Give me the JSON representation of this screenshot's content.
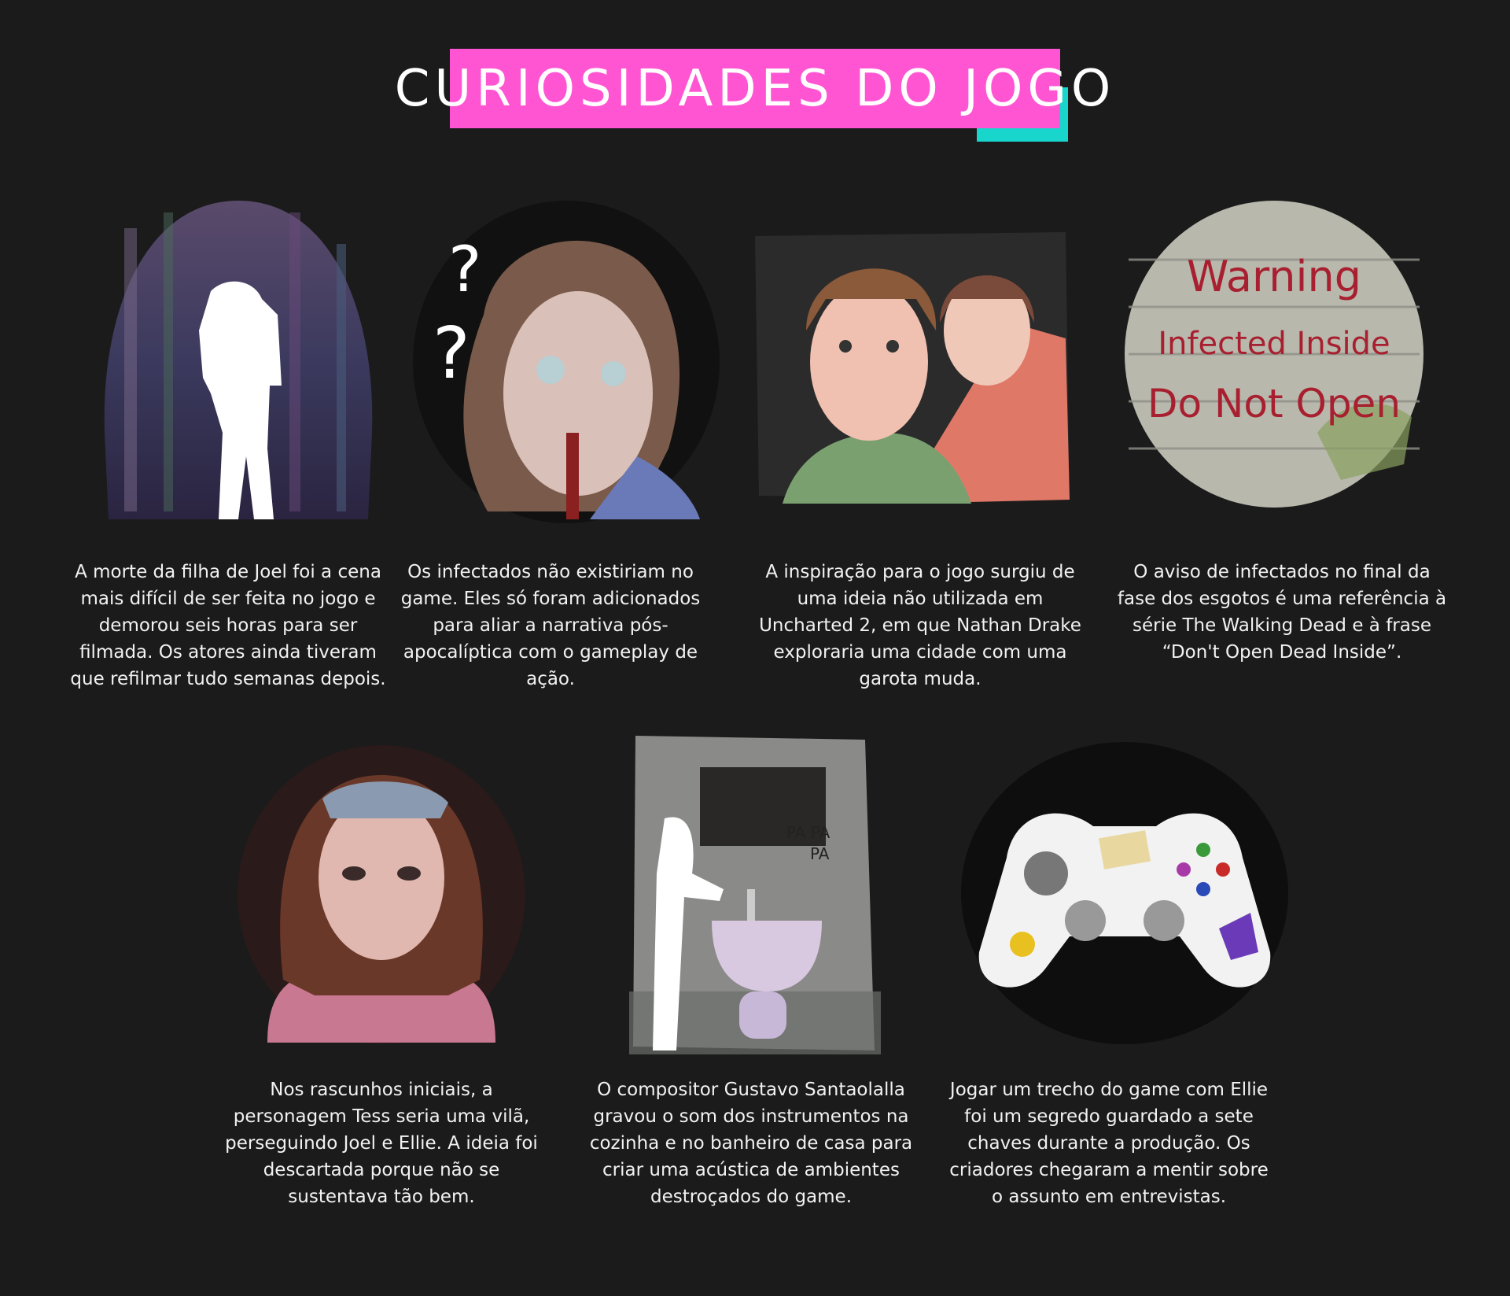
{
  "header": {
    "title": "CURIOSIDADES DO JOGO",
    "accent_colors": {
      "pink": "#ff55d2",
      "teal": "#19d6cd"
    }
  },
  "cards": [
    {
      "illustration": "silhouette-forest-illustration",
      "text": "A morte da filha de Joel foi a cena mais difícil de ser feita no jogo e demorou seis horas para ser filmada. Os atores ainda tiveram que refilmar tudo semanas depois."
    },
    {
      "illustration": "infected-clicker-illustration",
      "text": "Os infectados não existiriam no game. Eles só foram adicionados para aliar a narrativa pós-apocalíptica com o gameplay de ação."
    },
    {
      "illustration": "drake-and-girl-illustration",
      "text": "A inspiração para o jogo surgiu de uma ideia não utilizada em Uncharted 2, em que Nathan Drake exploraria uma cidade com uma garota muda."
    },
    {
      "illustration": "warning-wall-illustration",
      "sign": [
        "Warning",
        "Infected Inside",
        "Do Not Open"
      ],
      "text": "O aviso de infectados no final da fase dos esgotos é uma referência à série The Walking Dead e à frase “Don't Open Dead Inside”."
    },
    {
      "illustration": "tess-portrait-illustration",
      "text": "Nos rascunhos iniciais, a personagem Tess seria uma vilã, perseguindo Joel e Ellie. A ideia foi descartada porque não se sustentava tão bem."
    },
    {
      "illustration": "sink-composer-illustration",
      "sound": [
        "PA PA",
        "PA"
      ],
      "text": "O compositor Gustavo Santaolalla gravou o som dos instrumentos na cozinha e no banheiro de casa para criar uma acústica de ambientes destroçados do game."
    },
    {
      "illustration": "controller-illustration",
      "text": "Jogar um trecho do game com Ellie foi um segredo guardado a sete chaves durante a produção. Os criadores chegaram a mentir sobre o assunto em entrevistas."
    }
  ]
}
